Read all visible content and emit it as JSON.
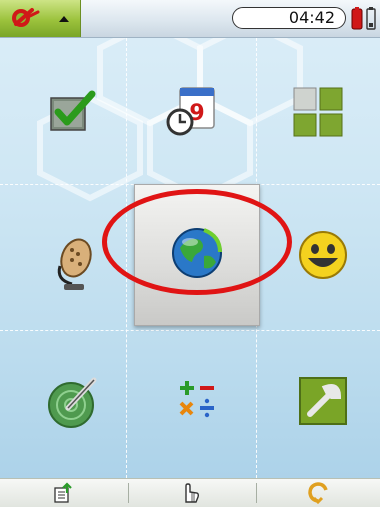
{
  "status_bar": {
    "time": "04:42",
    "battery_level": 0.25
  },
  "apps": {
    "tasks": "checkbox-icon",
    "calendar": {
      "icon": "calendar-clock-icon",
      "day": "9"
    },
    "app_grid": "grid-icon",
    "voice": "microphone-icon",
    "browser": "globe-icon",
    "emoji": "smiley-icon",
    "radar": "radar-pen-icon",
    "calculator": "calculator-icon",
    "settings": "wrench-icon"
  },
  "toolbar": {
    "left": "export-icon",
    "middle": "pointer-hand-icon",
    "right": "rotate-icon"
  },
  "colors": {
    "accent_green": "#8fba30",
    "highlight_red": "#e01414"
  }
}
